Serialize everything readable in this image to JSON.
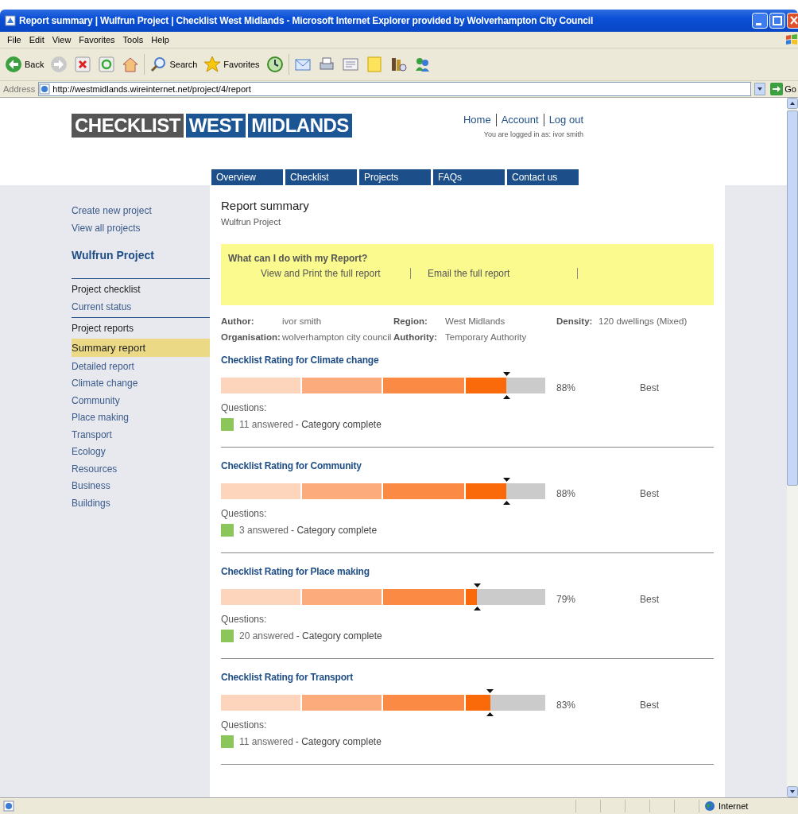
{
  "window": {
    "title": "Report summary | Wulfrun Project | Checklist West Midlands - Microsoft Internet Explorer provided by Wolverhampton City Council"
  },
  "menu": [
    "File",
    "Edit",
    "View",
    "Favorites",
    "Tools",
    "Help"
  ],
  "toolbar": [
    {
      "kind": "back",
      "label": "Back"
    },
    {
      "kind": "forward"
    },
    {
      "kind": "stop"
    },
    {
      "kind": "refresh"
    },
    {
      "kind": "home"
    },
    {
      "kind": "search",
      "label": "Search"
    },
    {
      "kind": "favorites",
      "label": "Favorites"
    },
    {
      "kind": "history"
    },
    {
      "kind": "mail"
    },
    {
      "kind": "print"
    },
    {
      "kind": "edit"
    },
    {
      "kind": "note"
    },
    {
      "kind": "research"
    },
    {
      "kind": "messenger"
    }
  ],
  "address": {
    "label": "Address",
    "url": "http://westmidlands.wireinternet.net/project/4/report",
    "go": "Go"
  },
  "site": {
    "logo": [
      "CHECKLIST",
      "WEST",
      "MIDLANDS"
    ],
    "top_links": [
      "Home",
      "Account",
      "Log out"
    ],
    "login": "You are logged in as: ivor smith",
    "nav": [
      "Overview",
      "Checklist",
      "Projects",
      "FAQs",
      "Contact us"
    ]
  },
  "sidebar": {
    "links": [
      "Create new project",
      "View all projects"
    ],
    "project": "Wulfrun Project",
    "groups": [
      {
        "items": [
          {
            "label": "Project checklist",
            "kind": "heading",
            "selected": false
          },
          {
            "label": "Current status",
            "kind": "link",
            "selected": false
          }
        ]
      },
      {
        "items": [
          {
            "label": "Project reports",
            "kind": "heading",
            "selected": false
          },
          {
            "label": "Summary report",
            "kind": "link",
            "selected": true
          },
          {
            "label": "Detailed report",
            "kind": "link",
            "selected": false
          },
          {
            "label": "Climate change",
            "kind": "link",
            "selected": false
          },
          {
            "label": "Community",
            "kind": "link",
            "selected": false
          },
          {
            "label": "Place making",
            "kind": "link",
            "selected": false
          },
          {
            "label": "Transport",
            "kind": "link",
            "selected": false
          },
          {
            "label": "Ecology",
            "kind": "link",
            "selected": false
          },
          {
            "label": "Resources",
            "kind": "link",
            "selected": false
          },
          {
            "label": "Business",
            "kind": "link",
            "selected": false
          },
          {
            "label": "Buildings",
            "kind": "link",
            "selected": false
          }
        ]
      }
    ]
  },
  "main": {
    "title": "Report summary",
    "subtitle": "Wulfrun Project",
    "callout": {
      "title": "What can I do with my Report?",
      "links": [
        "View and Print the full report",
        "Email the full report"
      ]
    },
    "meta": [
      [
        {
          "label": "Author:",
          "value": "ivor smith"
        },
        {
          "label": "Region:",
          "value": "West Midlands"
        },
        {
          "label": "Density:",
          "value": "120 dwellings (Mixed)"
        }
      ],
      [
        {
          "label": "Organisation:",
          "value": "wolverhampton city council"
        },
        {
          "label": "Authority:",
          "value": "Temporary Authority"
        }
      ]
    ],
    "ratings": [
      {
        "title": "Checklist Rating for Climate change",
        "level": 0.88,
        "percent": "88%",
        "grade": "Best",
        "questions": "Questions:",
        "answered": "11 answered",
        "status": "- Category complete",
        "complete": true
      },
      {
        "title": "Checklist Rating for Community",
        "level": 0.88,
        "percent": "88%",
        "grade": "Best",
        "questions": "Questions:",
        "answered": "3 answered",
        "status": "- Category complete",
        "complete": true
      },
      {
        "title": "Checklist Rating for Place making",
        "level": 0.79,
        "percent": "79%",
        "grade": "Best",
        "questions": "Questions:",
        "answered": "20 answered",
        "status": "- Category complete",
        "complete": true
      },
      {
        "title": "Checklist Rating for Transport",
        "level": 0.83,
        "percent": "83%",
        "grade": "Best",
        "questions": "Questions:",
        "answered": "11 answered",
        "status": "- Category complete",
        "complete": true
      }
    ]
  },
  "status_bar": {
    "zone": "Internet"
  }
}
